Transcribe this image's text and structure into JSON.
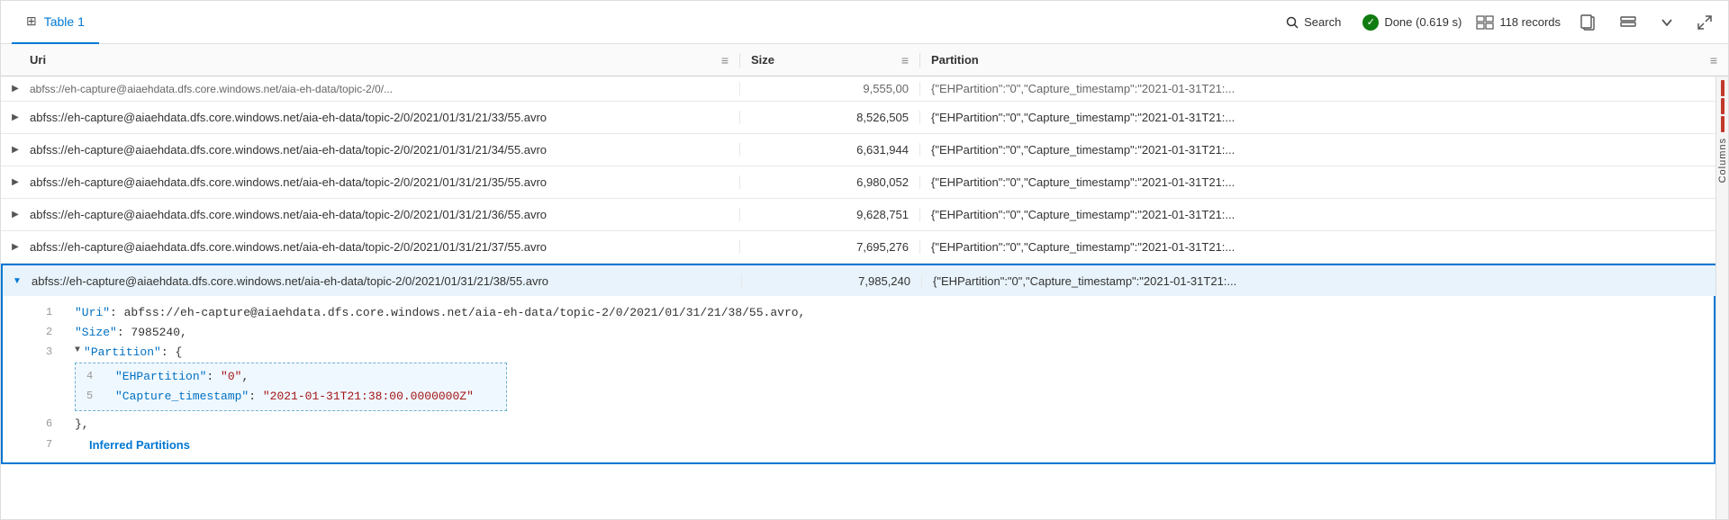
{
  "tab": {
    "icon": "⊞",
    "label": "Table 1"
  },
  "toolbar": {
    "search_label": "Search",
    "status_label": "Done (0.619 s)",
    "records_label": "118 records",
    "copy_icon": "📋",
    "layout_icon": "⊟",
    "chevron_icon": "∨",
    "expand_icon": "⤢"
  },
  "columns": {
    "uri": "Uri",
    "size": "Size",
    "partition": "Partition"
  },
  "rows": [
    {
      "uri": "abfss://eh-capture@aiaehdata.dfs.core.windows.net/aia-eh-data/topic-2/0/2021/01/31/21/33/55.avro",
      "size": "8,526,505",
      "partition": "{\"EHPartition\":\"0\",\"Capture_timestamp\":\"2021-01-31T21:...",
      "expanded": false,
      "partial": true
    },
    {
      "uri": "abfss://eh-capture@aiaehdata.dfs.core.windows.net/aia-eh-data/topic-2/0/2021/01/31/21/34/55.avro",
      "size": "6,631,944",
      "partition": "{\"EHPartition\":\"0\",\"Capture_timestamp\":\"2021-01-31T21:...",
      "expanded": false,
      "partial": false
    },
    {
      "uri": "abfss://eh-capture@aiaehdata.dfs.core.windows.net/aia-eh-data/topic-2/0/2021/01/31/21/35/55.avro",
      "size": "6,980,052",
      "partition": "{\"EHPartition\":\"0\",\"Capture_timestamp\":\"2021-01-31T21:...",
      "expanded": false,
      "partial": false
    },
    {
      "uri": "abfss://eh-capture@aiaehdata.dfs.core.windows.net/aia-eh-data/topic-2/0/2021/01/31/21/36/55.avro",
      "size": "9,628,751",
      "partition": "{\"EHPartition\":\"0\",\"Capture_timestamp\":\"2021-01-31T21:...",
      "expanded": false,
      "partial": false
    },
    {
      "uri": "abfss://eh-capture@aiaehdata.dfs.core.windows.net/aia-eh-data/topic-2/0/2021/01/31/21/37/55.avro",
      "size": "7,695,276",
      "partition": "{\"EHPartition\":\"0\",\"Capture_timestamp\":\"2021-01-31T21:...",
      "expanded": false,
      "partial": false
    },
    {
      "uri": "abfss://eh-capture@aiaehdata.dfs.core.windows.net/aia-eh-data/topic-2/0/2021/01/31/21/38/55.avro",
      "size": "7,985,240",
      "partition": "{\"EHPartition\":\"0\",\"Capture_timestamp\":\"2021-01-31T21:...",
      "expanded": true,
      "partial": false
    }
  ],
  "expanded_detail": {
    "lines": [
      {
        "num": "1",
        "content": "\"Uri\": abfss://eh-capture@aiaehdata.dfs.core.windows.net/aia-eh-data/topic-2/0/2021/01/31/21/38/55.avro,"
      },
      {
        "num": "2",
        "content": "\"Size\": 7985240,"
      },
      {
        "num": "3",
        "content": "\"Partition\": {",
        "expandable": true
      },
      {
        "num": "4",
        "content": "\"EHPartition\": \"0\","
      },
      {
        "num": "5",
        "content": "\"Capture_timestamp\": \"2021-01-31T21:38:00.0000000Z\""
      },
      {
        "num": "6",
        "content": "},"
      },
      {
        "num": "7",
        "content": "Inferred Partitions",
        "special": "inferred"
      }
    ]
  },
  "columns_panel": {
    "label": "Columns"
  }
}
